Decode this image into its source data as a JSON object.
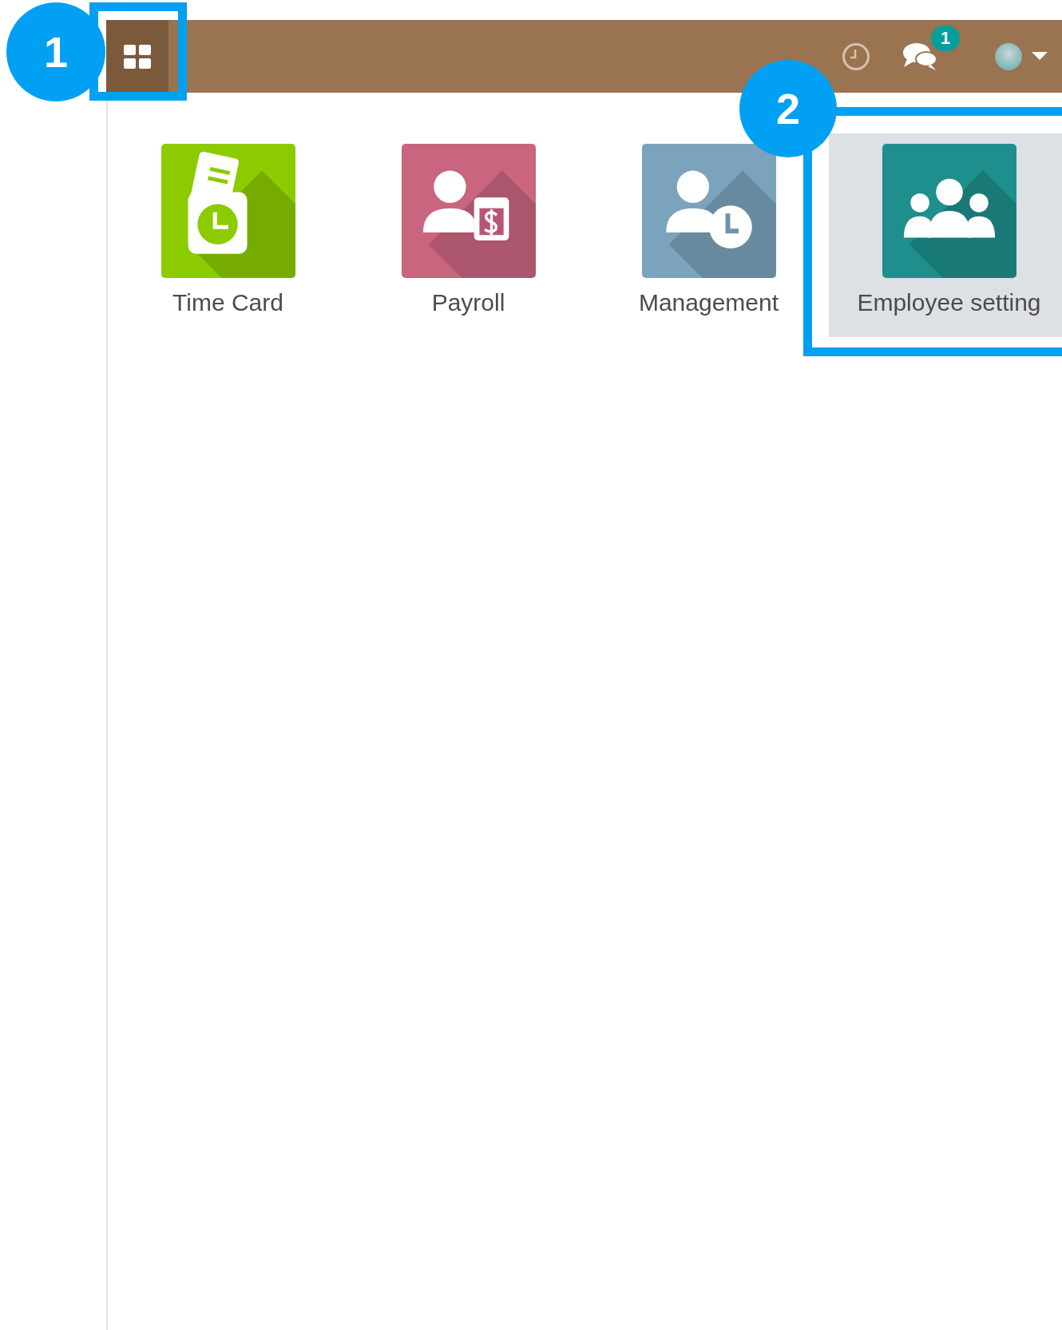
{
  "navbar": {
    "notifications": {
      "count": "1"
    }
  },
  "apps": [
    {
      "label": "Time Card",
      "kind": "timecard",
      "color": "#8bcb00",
      "selected": false
    },
    {
      "label": "Payroll",
      "kind": "payroll",
      "color": "#c9657f",
      "selected": false
    },
    {
      "label": "Management",
      "kind": "schedule",
      "color": "#7ba3bb",
      "selected": false
    },
    {
      "label": "Employee setting",
      "kind": "team",
      "color": "#1e8f8c",
      "selected": true
    }
  ],
  "callouts": [
    {
      "number": "1",
      "kind": "menu"
    },
    {
      "number": "2",
      "kind": "tile"
    }
  ]
}
